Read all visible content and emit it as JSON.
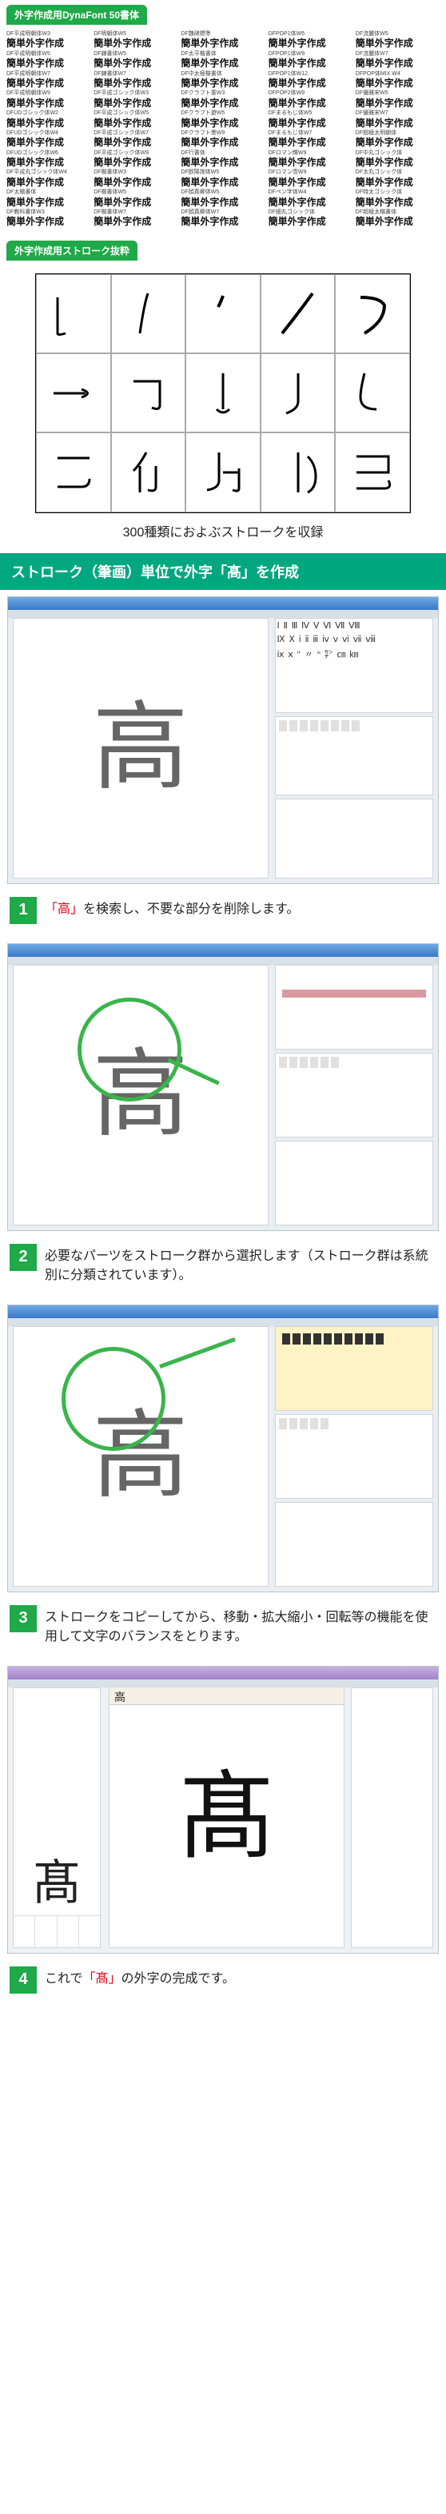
{
  "headers": {
    "dynafont": "外字作成用DynaFont 50書体",
    "strokes": "外字作成用ストローク抜粋"
  },
  "fonts": [
    {
      "label": "DF平成明朝体W3",
      "sample": "簡単外字作成"
    },
    {
      "label": "DF明朝体W5",
      "sample": "簡単外字作成"
    },
    {
      "label": "DF魏碑標準",
      "sample": "簡単外字作成"
    },
    {
      "label": "DFPOP1体W5",
      "sample": "簡単外字作成"
    },
    {
      "label": "DF流麗体W5",
      "sample": "簡単外字作成"
    },
    {
      "label": "DF平成明朝体W5",
      "sample": "簡単外字作成"
    },
    {
      "label": "DF隷書体W5",
      "sample": "簡単外字作成"
    },
    {
      "label": "DF太平楷書体",
      "sample": "簡単外字作成"
    },
    {
      "label": "DFPOP1体W9",
      "sample": "簡単外字作成"
    },
    {
      "label": "DF流麗体W7",
      "sample": "簡単外字作成"
    },
    {
      "label": "DF平成明朝体W7",
      "sample": "簡単外字作成"
    },
    {
      "label": "DF隷書体W7",
      "sample": "簡単外字作成"
    },
    {
      "label": "DF中太極楷書体",
      "sample": "簡単外字作成"
    },
    {
      "label": "DFPOP1体W12",
      "sample": "簡単外字作成"
    },
    {
      "label": "DFPOP体MIX W4",
      "sample": "簡単外字作成"
    },
    {
      "label": "DF平成明朝体W9",
      "sample": "簡単外字作成"
    },
    {
      "label": "DF平成ゴシック体W3",
      "sample": "簡単外字作成"
    },
    {
      "label": "DFクラフト童W3",
      "sample": "簡単外字作成"
    },
    {
      "label": "DFPOP2体W9",
      "sample": "簡単外字作成"
    },
    {
      "label": "DF優雅宋W5",
      "sample": "簡単外字作成"
    },
    {
      "label": "DFUDゴシック体W2",
      "sample": "簡単外字作成"
    },
    {
      "label": "DF平成ゴシック体W5",
      "sample": "簡単外字作成"
    },
    {
      "label": "DFクラフト遊W5",
      "sample": "簡単外字作成"
    },
    {
      "label": "DFまるもじ体W5",
      "sample": "簡単外字作成"
    },
    {
      "label": "DF優雅宋W7",
      "sample": "簡単外字作成"
    },
    {
      "label": "DFUDゴシック体W4",
      "sample": "簡単外字作成"
    },
    {
      "label": "DF平成ゴシック体W7",
      "sample": "簡単外字作成"
    },
    {
      "label": "DFクラフト墨W9",
      "sample": "簡単外字作成"
    },
    {
      "label": "DFまるもじ体W7",
      "sample": "簡単外字作成"
    },
    {
      "label": "DF超極太明朝体",
      "sample": "簡単外字作成"
    },
    {
      "label": "DFUDゴシック体W6",
      "sample": "簡単外字作成"
    },
    {
      "label": "DF平成ゴシック体W9",
      "sample": "簡単外字作成"
    },
    {
      "label": "DF行書体",
      "sample": "簡単外字作成"
    },
    {
      "label": "DFロマン輝W9",
      "sample": "簡単外字作成"
    },
    {
      "label": "DF中丸ゴシック体",
      "sample": "簡単外字作成"
    },
    {
      "label": "DF平成丸ゴシック体W4",
      "sample": "簡単外字作成"
    },
    {
      "label": "DF楷書体W3",
      "sample": "簡単外字作成"
    },
    {
      "label": "DF欧陽詢体W5",
      "sample": "簡単外字作成"
    },
    {
      "label": "DFロマン雪W9",
      "sample": "簡単外字作成"
    },
    {
      "label": "DF太丸ゴシック体",
      "sample": "簡単外字作成"
    },
    {
      "label": "DF太楷書体",
      "sample": "簡単外字作成"
    },
    {
      "label": "DF楷書体W5",
      "sample": "簡単外字作成"
    },
    {
      "label": "DF顔真卿体W5",
      "sample": "簡単外字作成"
    },
    {
      "label": "DFペン字体W4",
      "sample": "簡単外字作成"
    },
    {
      "label": "DF特太ゴシック体",
      "sample": "簡単外字作成"
    },
    {
      "label": "DF教科書体W3",
      "sample": "簡単外字作成"
    },
    {
      "label": "DF楷書体W7",
      "sample": "簡単外字作成"
    },
    {
      "label": "DF顔真卿体W7",
      "sample": "簡単外字作成"
    },
    {
      "label": "DF細丸ゴシック体",
      "sample": "簡単外字作成"
    },
    {
      "label": "DF超極太楷書体",
      "sample": "簡単外字作成"
    }
  ],
  "stroke_caption": "300種類におよぶストロークを収録",
  "banner": "ストローク（筆画）単位で外字「髙」を作成",
  "glyphs": {
    "source": "高",
    "target": "髙"
  },
  "roman": [
    "Ⅰ Ⅱ Ⅲ Ⅳ Ⅴ Ⅵ Ⅶ Ⅷ",
    "Ⅸ Ⅹ ⅰ ⅱ ⅲ ⅳ ⅴ ⅵ ⅶ ⅷ",
    "ⅸ ⅹ ″ 〃 ° ㌢ ㎝ ㎞"
  ],
  "steps": [
    {
      "n": "1",
      "pre": "",
      "kw": "「高」",
      "post": "を検索し、不要な部分を削除します。"
    },
    {
      "n": "2",
      "pre": "必要なパーツをストローク群から選択します（ストローク群は系統別に分類されています）。",
      "kw": "",
      "post": ""
    },
    {
      "n": "3",
      "pre": "ストロークをコピーしてから、移動・拡大縮小・回転等の機能を使用して文字のバランスをとります。",
      "kw": "",
      "post": ""
    },
    {
      "n": "4",
      "pre": "これで",
      "kw": "「髙」",
      "post": "の外字の完成です。"
    }
  ]
}
